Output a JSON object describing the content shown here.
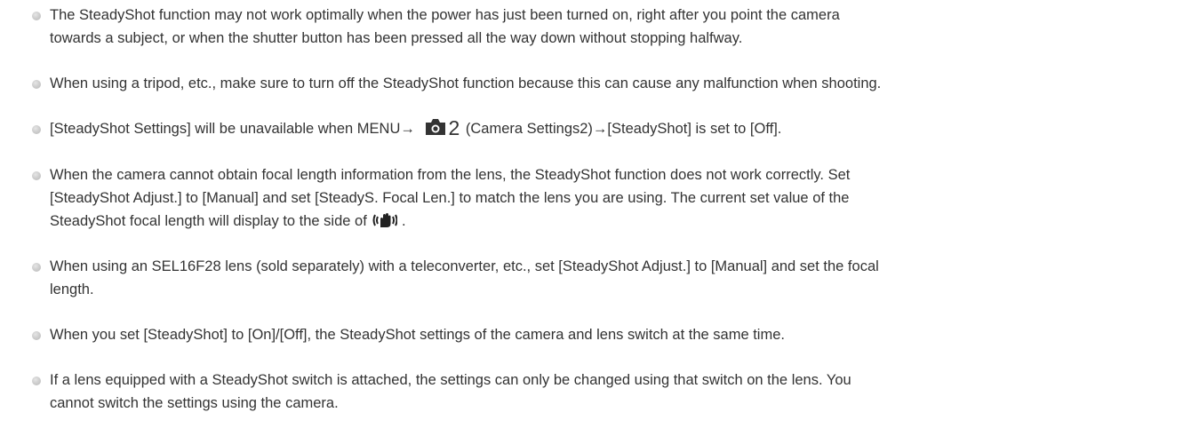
{
  "notes": [
    {
      "line1": "The SteadyShot function may not work optimally when the power has just been turned on, right after you point the camera",
      "line2": "towards a subject, or when the shutter button has been pressed all the way down without stopping halfway."
    },
    {
      "line1": "When using a tripod, etc., make sure to turn off the SteadyShot function because this can cause any malfunction when shooting."
    },
    {
      "before_icon": "[SteadyShot Settings] will be unavailable when MENU→",
      "icon_name": "camera-settings-icon",
      "icon_number": "2",
      "after_icon": "(Camera Settings2)→[SteadyShot] is set to [Off]."
    },
    {
      "line1": "When the camera cannot obtain focal length information from the lens, the SteadyShot function does not work correctly. Set",
      "line2": "[SteadyShot Adjust.] to [Manual] and set [SteadyS. Focal Len.] to match the lens you are using. The current set value of the",
      "line3_before_icon": "SteadyShot focal length will display to the side of",
      "icon_name": "steadyshot-hand-icon",
      "line3_after_icon": "."
    },
    {
      "line1": "When using an SEL16F28 lens (sold separately) with a teleconverter, etc., set [SteadyShot Adjust.] to [Manual] and set the focal",
      "line2": "length."
    },
    {
      "line1": "When you set [SteadyShot] to [On]/[Off], the SteadyShot settings of the camera and lens switch at the same time."
    },
    {
      "line1": "If a lens equipped with a SteadyShot switch is attached, the settings can only be changed using that switch on the lens. You",
      "line2": "cannot switch the settings using the camera."
    }
  ]
}
